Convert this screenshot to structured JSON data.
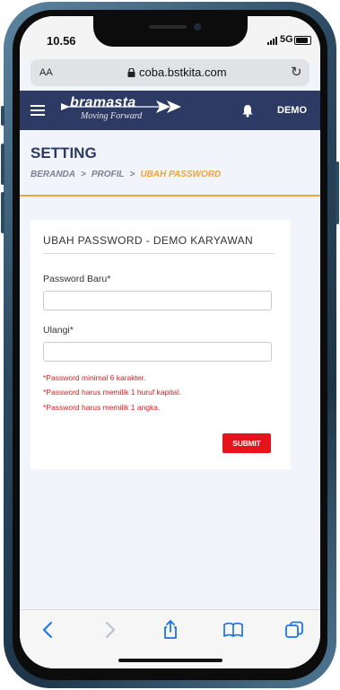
{
  "status_bar": {
    "time": "10.56",
    "network": "5G"
  },
  "browser": {
    "text_size_button": "AA",
    "url": "coba.bstkita.com"
  },
  "app_header": {
    "logo_word": "bramasta",
    "logo_tagline": "Moving Forward",
    "user_label": "DEMO"
  },
  "page": {
    "title": "SETTING",
    "breadcrumb": [
      "BERANDA",
      "PROFIL",
      "UBAH PASSWORD"
    ],
    "breadcrumb_separator": ">"
  },
  "form": {
    "title": "UBAH PASSWORD - DEMO KARYAWAN",
    "new_password_label": "Password Baru*",
    "new_password_value": "",
    "repeat_label": "Ulangi*",
    "repeat_value": "",
    "hints": [
      "*Password minimal 6 karakter.",
      "*Password harus memilik 1 huruf kapital.",
      "*Password harus memilik 1 angka."
    ],
    "submit_label": "SUBMIT"
  },
  "colors": {
    "navbar": "#2d3a63",
    "accent": "#f0a43a",
    "error": "#e02020",
    "submit": "#e5141b",
    "ios_blue": "#1a73e8"
  }
}
